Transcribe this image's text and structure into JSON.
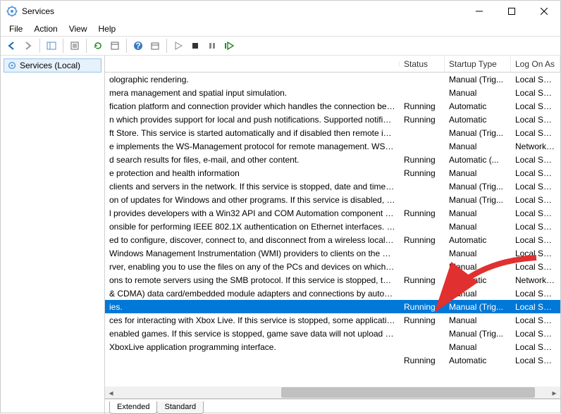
{
  "window": {
    "title": "Services"
  },
  "menu": {
    "file": "File",
    "action": "Action",
    "view": "View",
    "help": "Help"
  },
  "tree": {
    "root": "Services (Local)"
  },
  "columns": {
    "status": "Status",
    "startup": "Startup Type",
    "logon": "Log On As"
  },
  "tabs": {
    "extended": "Extended",
    "standard": "Standard"
  },
  "rows": [
    {
      "desc": "olographic rendering.",
      "status": "",
      "startup": "Manual (Trig...",
      "logon": "Local Service"
    },
    {
      "desc": "mera management and spatial input simulation.",
      "status": "",
      "startup": "Manual",
      "logon": "Local Syste..."
    },
    {
      "desc": "fication platform and connection provider which handles the connection bet...",
      "status": "Running",
      "startup": "Automatic",
      "logon": "Local Syste..."
    },
    {
      "desc": "n which provides support for local and push notifications. Supported notificat...",
      "status": "Running",
      "startup": "Automatic",
      "logon": "Local Syste..."
    },
    {
      "desc": "ft Store.  This service is started automatically and if disabled then remote instal...",
      "status": "",
      "startup": "Manual (Trig...",
      "logon": "Local Syste..."
    },
    {
      "desc": "e implements the WS-Management protocol for remote management. WS-M...",
      "status": "",
      "startup": "Manual",
      "logon": "Network S..."
    },
    {
      "desc": "d search results for files, e-mail, and other content.",
      "status": "Running",
      "startup": "Automatic (...",
      "logon": "Local Syste..."
    },
    {
      "desc": "e protection and health information",
      "status": "Running",
      "startup": "Manual",
      "logon": "Local Syste..."
    },
    {
      "desc": "clients and servers in the network. If this service is stopped, date and time syn...",
      "status": "",
      "startup": "Manual (Trig...",
      "logon": "Local Service"
    },
    {
      "desc": "on of updates for Windows and other programs. If this service is disabled, user...",
      "status": "",
      "startup": "Manual (Trig...",
      "logon": "Local Syste..."
    },
    {
      "desc": "l provides developers with a Win32 API and COM Automation component for ...",
      "status": "Running",
      "startup": "Manual",
      "logon": "Local Syste..."
    },
    {
      "desc": "onsible for performing IEEE 802.1X authentication on Ethernet interfaces. If y...",
      "status": "",
      "startup": "Manual",
      "logon": "Local Syste..."
    },
    {
      "desc": "ed to configure, discover, connect to, and disconnect from a wireless local are...",
      "status": "Running",
      "startup": "Automatic",
      "logon": "Local Syste..."
    },
    {
      "desc": "Windows Management Instrumentation (WMI) providers to clients on the net...",
      "status": "",
      "startup": "Manual",
      "logon": "Local Syste..."
    },
    {
      "desc": "rver, enabling you to use the files on any of the PCs and devices on which you...",
      "status": "",
      "startup": "Manual",
      "logon": "Local Service"
    },
    {
      "desc": "ons to remote servers using the SMB protocol. If this service is stopped, these c...",
      "status": "Running",
      "startup": "Automatic",
      "logon": "Network S..."
    },
    {
      "desc": "& CDMA) data card/embedded module adapters and connections by auto-co...",
      "status": "",
      "startup": "Manual",
      "logon": "Local Syste..."
    },
    {
      "desc": "ies.",
      "status": "Running",
      "startup": "Manual (Trig...",
      "logon": "Local Syste...",
      "selected": true
    },
    {
      "desc": "ces for interacting with Xbox Live. If this service is stopped, some applications...",
      "status": "Running",
      "startup": "Manual",
      "logon": "Local Syste..."
    },
    {
      "desc": "enabled games.  If this service is stopped, game save data will not upload to or...",
      "status": "",
      "startup": "Manual (Trig...",
      "logon": "Local Syste..."
    },
    {
      "desc": "XboxLive application programming interface.",
      "status": "",
      "startup": "Manual",
      "logon": "Local Syste..."
    },
    {
      "desc": "",
      "status": "Running",
      "startup": "Automatic",
      "logon": "Local Syste..."
    }
  ]
}
